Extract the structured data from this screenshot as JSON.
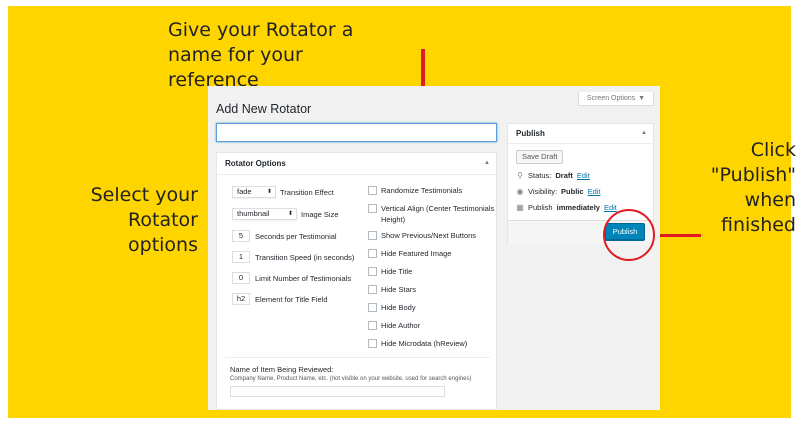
{
  "callouts": {
    "top_line1": "Give your Rotator a",
    "top_line2": "name for your reference",
    "left_line1": "Select your Rotator",
    "left_line2": "options",
    "right_line1": "Click \"Publish\"",
    "right_line2": "when finished"
  },
  "colors": {
    "background": "#FFD500",
    "annotation": "#e01b22",
    "primary_button": "#0085ba",
    "link": "#0073aa"
  },
  "screen_options": {
    "label": "Screen Options",
    "icon": "caret-down-icon"
  },
  "page_title": "Add New Rotator",
  "title_input": {
    "value": ""
  },
  "rotator_options": {
    "heading": "Rotator Options",
    "transition_effect": {
      "value": "fade",
      "label": "Transition Effect"
    },
    "image_size": {
      "value": "thumbnail",
      "label": "Image Size"
    },
    "seconds": {
      "value": "5",
      "label": "Seconds per Testimonial"
    },
    "transition_speed": {
      "value": "1",
      "label": "Transition Speed (in seconds)"
    },
    "limit": {
      "value": "0",
      "label": "Limit Number of Testimonials"
    },
    "title_element": {
      "value": "h2",
      "label": "Element for Title Field"
    },
    "checkboxes": [
      "Randomize Testimonials",
      "Vertical Align (Center Testimonials Height)",
      "Show Previous/Next Buttons",
      "Hide Featured Image",
      "Hide Title",
      "Hide Stars",
      "Hide Body",
      "Hide Author",
      "Hide Microdata (hReview)"
    ],
    "item_reviewed": {
      "label": "Name of Item Being Reviewed:",
      "help": "Company Name, Product Name, etc. (not visible on your website, used for search engines)",
      "value": ""
    }
  },
  "publish_box": {
    "heading": "Publish",
    "save_draft": "Save Draft",
    "status_label": "Status:",
    "status_value": "Draft",
    "visibility_label": "Visibility:",
    "visibility_value": "Public",
    "publish_label": "Publish",
    "publish_value": "immediately",
    "edit_link": "Edit",
    "publish_button": "Publish"
  }
}
